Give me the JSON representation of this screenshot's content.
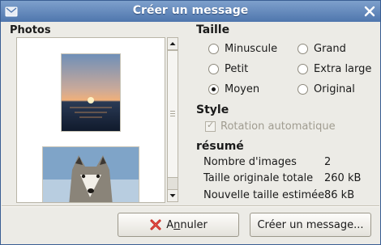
{
  "window": {
    "title": "Créer un message"
  },
  "photos": {
    "label": "Photos",
    "thumbnails": [
      {
        "name": "sunset-photo"
      },
      {
        "name": "wolf-photo"
      }
    ]
  },
  "size": {
    "label": "Taille",
    "options": [
      {
        "label": "Minuscule",
        "selected": false
      },
      {
        "label": "Grand",
        "selected": false
      },
      {
        "label": "Petit",
        "selected": false
      },
      {
        "label": "Extra large",
        "selected": false
      },
      {
        "label": "Moyen",
        "selected": true
      },
      {
        "label": "Original",
        "selected": false
      }
    ]
  },
  "style": {
    "label": "Style",
    "auto_rotate_label": "Rotation automatique",
    "auto_rotate_checked": true,
    "auto_rotate_enabled": false
  },
  "summary": {
    "label": "résumé",
    "rows": [
      {
        "label": "Nombre d'images",
        "value": "2"
      },
      {
        "label": "Taille originale totale",
        "value": "260 kB"
      },
      {
        "label": "Nouvelle taille estimée",
        "value": "86 kB"
      }
    ]
  },
  "buttons": {
    "cancel_label": "Annuler",
    "cancel_mnemonic": "n",
    "create_label": "Créer un message..."
  },
  "colors": {
    "titlebar": "#4f76ad",
    "window_bg": "#ecebe6"
  }
}
